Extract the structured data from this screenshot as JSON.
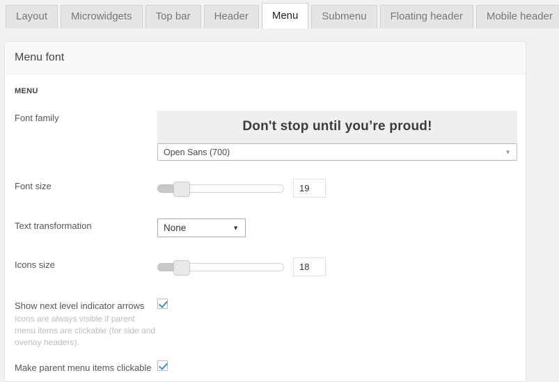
{
  "tabs": [
    {
      "label": "Layout",
      "active": false
    },
    {
      "label": "Microwidgets",
      "active": false
    },
    {
      "label": "Top bar",
      "active": false
    },
    {
      "label": "Header",
      "active": false
    },
    {
      "label": "Menu",
      "active": true
    },
    {
      "label": "Submenu",
      "active": false
    },
    {
      "label": "Floating header",
      "active": false
    },
    {
      "label": "Mobile header",
      "active": false
    }
  ],
  "panel": {
    "title": "Menu font",
    "section_label": "MENU"
  },
  "fields": {
    "font_family": {
      "label": "Font family",
      "preview_text": "Don't stop until you’re proud!",
      "value": "Open Sans (700)",
      "arrow_icon": "▼"
    },
    "font_size": {
      "label": "Font size",
      "value": "19"
    },
    "text_transformation": {
      "label": "Text transformation",
      "value": "None",
      "arrow_icon": "▼"
    },
    "icons_size": {
      "label": "Icons size",
      "value": "18"
    },
    "show_arrows": {
      "label": "Show next level indicator arrows",
      "description": "Icons are always visible if parent menu items are clickable (for side and overlay headers).",
      "checked": true
    },
    "parent_clickable": {
      "label": "Make parent menu items clickable",
      "checked": true
    }
  },
  "colors": {
    "page_background": "#f1f1f1",
    "panel_background": "#ffffff",
    "accent_check": "#3a8fc7",
    "preview_background": "#efefef"
  }
}
